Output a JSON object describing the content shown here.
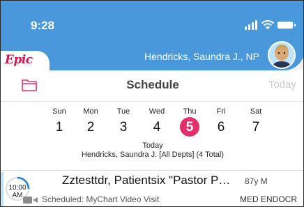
{
  "status_bar": {
    "time": "9:28"
  },
  "header": {
    "logo": "Epic",
    "user_name": "Hendricks, Saundra J., NP",
    "accent_color": "#4a98dc"
  },
  "toolbar": {
    "folder_icon": "folder-icon",
    "title": "Schedule",
    "today_button": "Today"
  },
  "week": [
    {
      "day": "Sun",
      "date": "1"
    },
    {
      "day": "Mon",
      "date": "2"
    },
    {
      "day": "Tue",
      "date": "3"
    },
    {
      "day": "Wed",
      "date": "4"
    },
    {
      "day": "Thu",
      "date": "5",
      "selected": true
    },
    {
      "day": "Fri",
      "date": "6"
    },
    {
      "day": "Sat",
      "date": "7"
    }
  ],
  "selected_color": "#e3306a",
  "schedule_summary": {
    "day_label": "Today",
    "department_line": "Hendricks, Saundra J. [All Depts] (4 Total)"
  },
  "appointments": [
    {
      "time": "10:00",
      "ampm": "AM",
      "patient": "Zztesttdr, Patientsix \"Pastor Patient...",
      "age": "87y M",
      "visit_type": "Scheduled: MyChart Video Visit",
      "department": "MED ENDOCR",
      "icon": "video-camera-icon"
    }
  ]
}
